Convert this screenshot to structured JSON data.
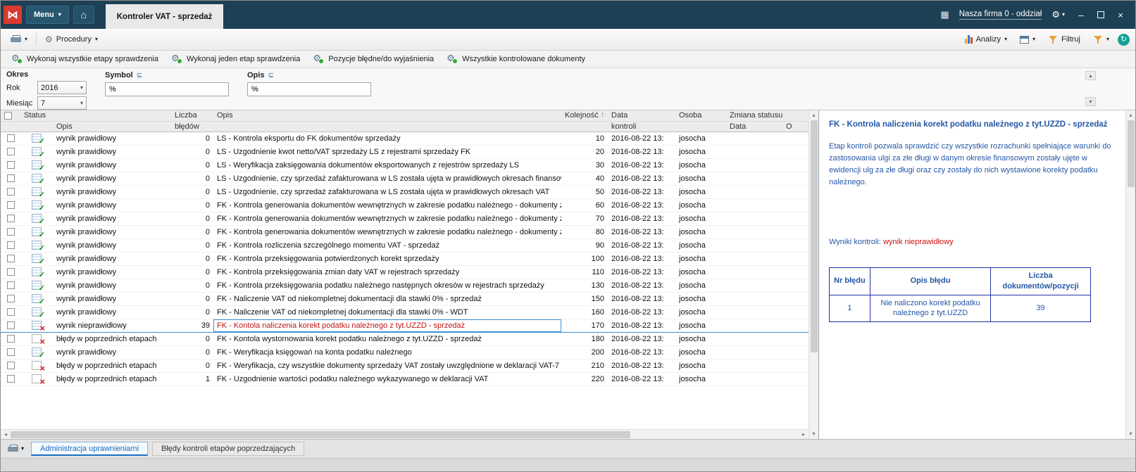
{
  "icons": {
    "caret_down": "▾",
    "home": "⌂",
    "gear": "⚙",
    "apps": "▦",
    "logo": "⋈",
    "sort_asc": "↑",
    "operator": "⊆",
    "refresh": "↻",
    "minimize": "–",
    "close": "×",
    "scroll_up": "▴",
    "scroll_down": "▾",
    "scroll_left": "◂",
    "scroll_right": "▸"
  },
  "titlebar": {
    "menu_label": "Menu",
    "tab_title": "Kontroler VAT - sprzedaż",
    "company": "Nasza firma 0 - oddział"
  },
  "toolbar": {
    "procedury": "Procedury",
    "analizy": "Analizy",
    "filtruj": "Filtruj"
  },
  "actions": [
    "Wykonaj wszystkie etapy sprawdzenia",
    "Wykonaj jeden etap sprawdzenia",
    "Pozycje błędne/do wyjaśnienia",
    "Wszystkie kontrolowane dokumenty"
  ],
  "filters": {
    "okres": "Okres",
    "rok_label": "Rok",
    "rok_value": "2016",
    "miesiac_label": "Miesiąc",
    "miesiac_value": "7",
    "symbol_label": "Symbol",
    "symbol_value": "%",
    "opis_label": "Opis",
    "opis_value": "%"
  },
  "table": {
    "headers": {
      "status": "Status",
      "status_opis": "Opis",
      "liczba_1": "Liczba",
      "liczba_2": "błędów",
      "opis": "Opis",
      "kolejnosc": "Kolejność",
      "data_1": "Data",
      "data_2": "kontroli",
      "osoba": "Osoba",
      "zmiana": "Zmiana statusu",
      "zmiana_data": "Data",
      "zmiana_o": "O"
    },
    "rows": [
      {
        "status": "ok",
        "status_text": "wynik prawidłowy",
        "bledy": "0",
        "opis": "LS - Kontrola eksportu do FK dokumentów sprzedaży",
        "kolejnosc": "10",
        "data": "2016-08-22 13:",
        "osoba": "josocha"
      },
      {
        "status": "ok",
        "status_text": "wynik prawidłowy",
        "bledy": "0",
        "opis": "LS - Uzgodnienie kwot netto/VAT sprzedaży LS  z rejestrami sprzedaży FK",
        "kolejnosc": "20",
        "data": "2016-08-22 13:",
        "osoba": "josocha"
      },
      {
        "status": "ok",
        "status_text": "wynik prawidłowy",
        "bledy": "0",
        "opis": "LS - Weryfikacja zaksięgowania dokumentów eksportowanych z rejestrów sprzedaży LS",
        "kolejnosc": "30",
        "data": "2016-08-22 13:",
        "osoba": "josocha"
      },
      {
        "status": "ok",
        "status_text": "wynik prawidłowy",
        "bledy": "0",
        "opis": "LS - Uzgodnienie, czy sprzedaż zafakturowana w LS została ujęta w prawidłowych okresach finansowy",
        "kolejnosc": "40",
        "data": "2016-08-22 13:",
        "osoba": "josocha"
      },
      {
        "status": "ok",
        "status_text": "wynik prawidłowy",
        "bledy": "0",
        "opis": "LS - Uzgodnienie, czy sprzedaż zafakturowana w LS została ujęta w prawidłowych okresach VAT",
        "kolejnosc": "50",
        "data": "2016-08-22 13:",
        "osoba": "josocha"
      },
      {
        "status": "ok",
        "status_text": "wynik prawidłowy",
        "bledy": "0",
        "opis": "FK - Kontrola generowania dokumentów wewnętrznych w zakresie podatku należnego - dokumenty źró",
        "kolejnosc": "60",
        "data": "2016-08-22 13:",
        "osoba": "josocha"
      },
      {
        "status": "ok",
        "status_text": "wynik prawidłowy",
        "bledy": "0",
        "opis": "FK - Kontrola generowania dokumentów wewnętrznych w zakresie podatku należnego - dokumenty źró",
        "kolejnosc": "70",
        "data": "2016-08-22 13:",
        "osoba": "josocha"
      },
      {
        "status": "ok",
        "status_text": "wynik prawidłowy",
        "bledy": "0",
        "opis": "FK - Kontrola generowania dokumentów wewnętrznych w zakresie podatku należnego - dokumenty źró",
        "kolejnosc": "80",
        "data": "2016-08-22 13:",
        "osoba": "josocha"
      },
      {
        "status": "ok",
        "status_text": "wynik prawidłowy",
        "bledy": "0",
        "opis": "FK - Kontrola rozliczenia szczególnego momentu VAT - sprzedaż",
        "kolejnosc": "90",
        "data": "2016-08-22 13:",
        "osoba": "josocha"
      },
      {
        "status": "ok",
        "status_text": "wynik prawidłowy",
        "bledy": "0",
        "opis": "FK - Kontrola przeksięgowania potwierdzonych korekt sprzedaży",
        "kolejnosc": "100",
        "data": "2016-08-22 13:",
        "osoba": "josocha"
      },
      {
        "status": "ok",
        "status_text": "wynik prawidłowy",
        "bledy": "0",
        "opis": "FK - Kontrola przeksięgowania zmian daty VAT w rejestrach sprzedaży",
        "kolejnosc": "110",
        "data": "2016-08-22 13:",
        "osoba": "josocha"
      },
      {
        "status": "ok",
        "status_text": "wynik prawidłowy",
        "bledy": "0",
        "opis": "FK - Kontrola przeksięgowania podatku należnego następnych okresów  w rejestrach sprzedaży",
        "kolejnosc": "130",
        "data": "2016-08-22 13:",
        "osoba": "josocha"
      },
      {
        "status": "ok",
        "status_text": "wynik prawidłowy",
        "bledy": "0",
        "opis": "FK - Naliczenie VAT od niekompletnej dokumentacji dla stawki 0% - sprzedaż",
        "kolejnosc": "150",
        "data": "2016-08-22 13:",
        "osoba": "josocha"
      },
      {
        "status": "ok",
        "status_text": "wynik prawidłowy",
        "bledy": "0",
        "opis": "FK - Naliczenie VAT od niekompletnej dokumentacji dla stawki 0% -  WDT",
        "kolejnosc": "160",
        "data": "2016-08-22 13:",
        "osoba": "josocha"
      },
      {
        "status": "bad",
        "status_text": "wynik nieprawidłowy",
        "bledy": "39",
        "opis": "FK - Kontola naliczenia korekt podatku należnego z tyt.UZZD - sprzedaż",
        "kolejnosc": "170",
        "data": "2016-08-22 13:",
        "osoba": "josocha",
        "selected": true
      },
      {
        "status": "prev",
        "status_text": "błędy w poprzednich etapach",
        "bledy": "0",
        "opis": "FK - Kontola wystornowania korekt podatku należnego z tyt.UZZD - sprzedaż",
        "kolejnosc": "180",
        "data": "2016-08-22 13:",
        "osoba": "josocha"
      },
      {
        "status": "ok",
        "status_text": "wynik prawidłowy",
        "bledy": "0",
        "opis": "FK - Weryfikacja księgowań na konta podatku należnego",
        "kolejnosc": "200",
        "data": "2016-08-22 13:",
        "osoba": "josocha"
      },
      {
        "status": "prev",
        "status_text": "błędy w poprzednich etapach",
        "bledy": "0",
        "opis": "FK - Weryfikacja, czy wszystkie dokumenty sprzedaży VAT zostały uwzględnione w deklaracji VAT-7",
        "kolejnosc": "210",
        "data": "2016-08-22 13:",
        "osoba": "josocha"
      },
      {
        "status": "prev",
        "status_text": "błędy w poprzednich etapach",
        "bledy": "1",
        "opis": "FK - Uzgodnienie wartości podatku należnego wykazywanego w deklaracji VAT",
        "kolejnosc": "220",
        "data": "2016-08-22 13:",
        "osoba": "josocha"
      }
    ]
  },
  "detail_panel": {
    "title": "FK - Kontrola naliczenia korekt podatku należnego z tyt.UZZD - sprzedaż",
    "description": "Etap kontroli pozwala sprawdzić czy wszystkie rozrachunki spełniające warunki do zastosowania ulgi za złe długi w danym okresie finansowym zostały ujęte w ewidencji ulg za złe długi oraz czy zostały do nich wystawione korekty podatku należnego.",
    "result_label": "Wyniki kontroli:",
    "result_value": "wynik nieprawidłowy",
    "error_table": {
      "headers": [
        "Nr błędu",
        "Opis błędu",
        "Liczba dokumentów/pozycji"
      ],
      "rows": [
        [
          "1",
          "Nie naliczono korekt podatku należnego z tyt.UZZD",
          "39"
        ]
      ]
    }
  },
  "bottom_bar": {
    "tabs": [
      "Administracja uprawnieniami",
      "Błędy kontroli etapów poprzedzających"
    ]
  },
  "colors": {
    "titlebar": "#1d4054",
    "accent_blue": "#2457a7",
    "error_red": "#cf1212",
    "selected_border": "#3f8fd4",
    "sorted_column": "#0a66c2"
  }
}
